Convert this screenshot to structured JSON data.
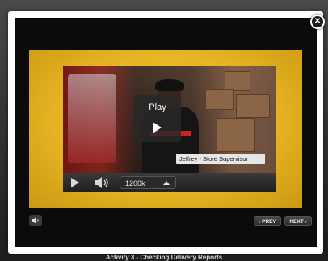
{
  "modal": {
    "close_icon": "close-icon"
  },
  "video": {
    "play_overlay_label": "Play",
    "caption": "Jeffrey - Store Supervisor",
    "controls": {
      "play_icon": "play-icon",
      "volume_icon": "volume-icon",
      "quality": "1200k",
      "quality_icon": "caret-up-icon"
    }
  },
  "nav": {
    "mute_icon": "speaker-icon",
    "prev_label": "‹ PREV",
    "next_label": "NEXT ›"
  },
  "footer": {
    "title": "Activity 3 - Checking Delivery Reports"
  },
  "colors": {
    "panel_gold": "#e6b423",
    "modal_border": "#ffffff",
    "caption_bg": "#e6e6e6"
  }
}
